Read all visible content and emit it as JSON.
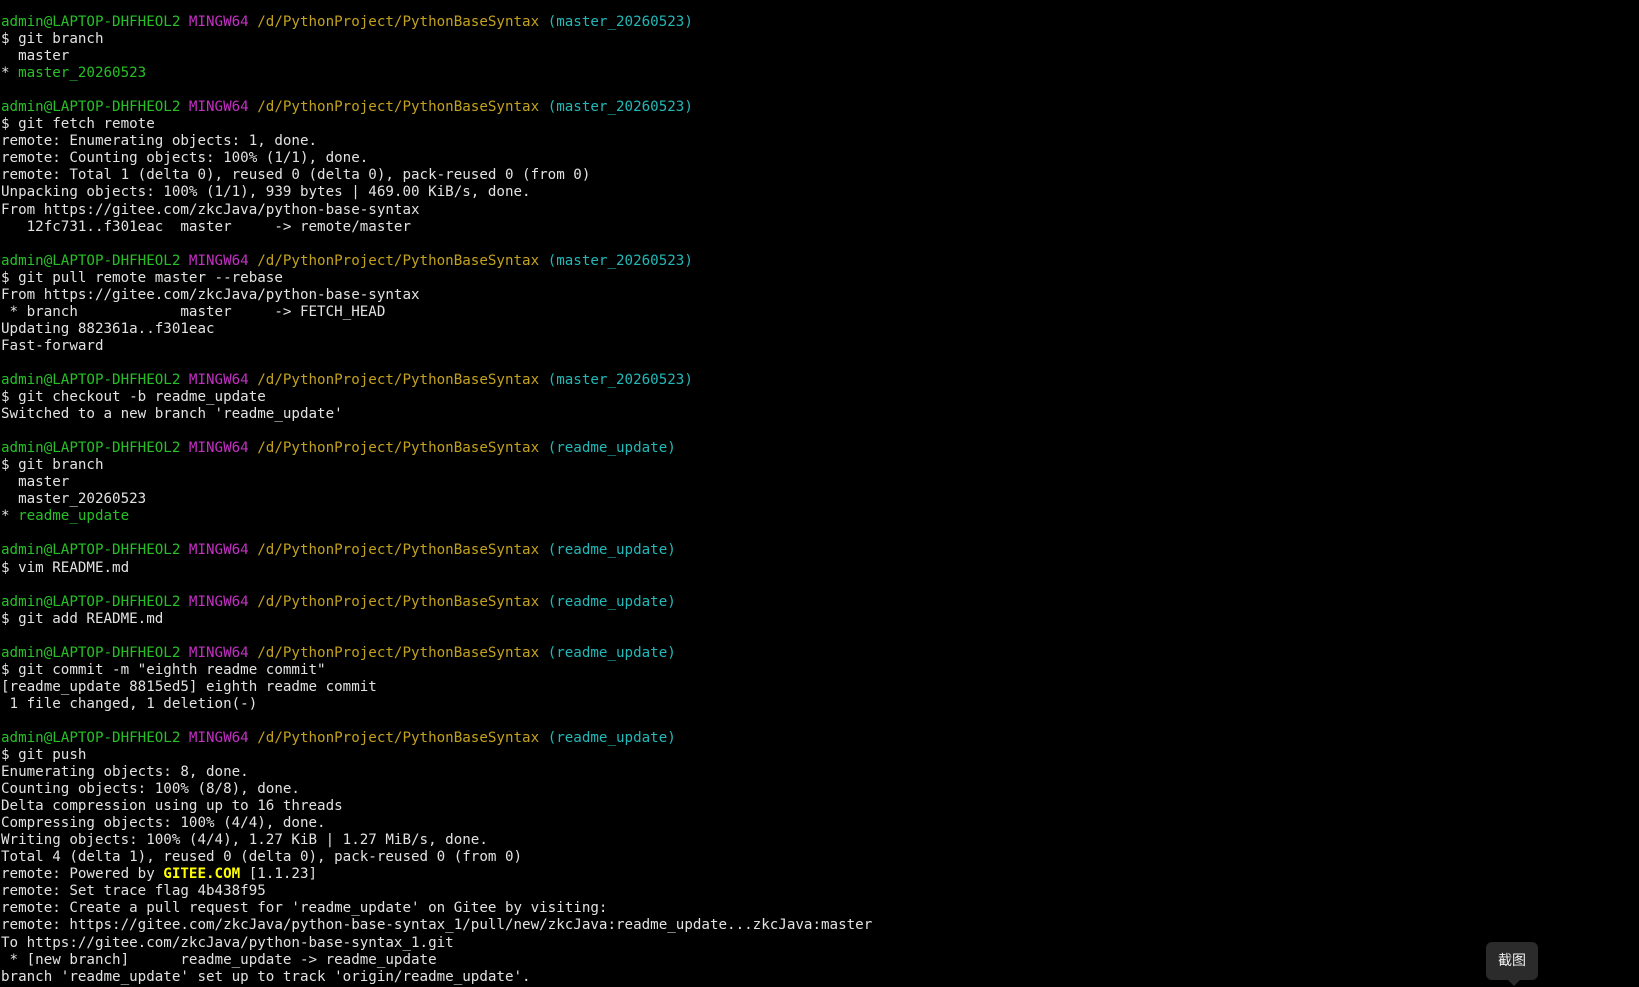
{
  "prompt": {
    "user_host": "admin@LAPTOP-DHFHEOL2",
    "env": "MINGW64",
    "path": "/d/PythonProject/PythonBaseSyntax"
  },
  "blocks": [
    {
      "branch": "(master_20260523)",
      "command": "$ git branch",
      "output": [
        {
          "text": "  master"
        },
        {
          "text": "* ",
          "current": "master_20260523"
        }
      ]
    },
    {
      "branch": "(master_20260523)",
      "command": "$ git fetch remote",
      "output": [
        {
          "text": "remote: Enumerating objects: 1, done."
        },
        {
          "text": "remote: Counting objects: 100% (1/1), done."
        },
        {
          "text": "remote: Total 1 (delta 0), reused 0 (delta 0), pack-reused 0 (from 0)"
        },
        {
          "text": "Unpacking objects: 100% (1/1), 939 bytes | 469.00 KiB/s, done."
        },
        {
          "text": "From https://gitee.com/zkcJava/python-base-syntax"
        },
        {
          "text": "   12fc731..f301eac  master     -> remote/master"
        }
      ]
    },
    {
      "branch": "(master_20260523)",
      "command": "$ git pull remote master --rebase",
      "output": [
        {
          "text": "From https://gitee.com/zkcJava/python-base-syntax"
        },
        {
          "text": " * branch            master     -> FETCH_HEAD"
        },
        {
          "text": "Updating 882361a..f301eac"
        },
        {
          "text": "Fast-forward"
        }
      ]
    },
    {
      "branch": "(master_20260523)",
      "command": "$ git checkout -b readme_update",
      "output": [
        {
          "text": "Switched to a new branch 'readme_update'"
        }
      ]
    },
    {
      "branch": "(readme_update)",
      "command": "$ git branch",
      "output": [
        {
          "text": "  master"
        },
        {
          "text": "  master_20260523"
        },
        {
          "text": "* ",
          "current": "readme_update"
        }
      ]
    },
    {
      "branch": "(readme_update)",
      "command": "$ vim README.md",
      "output": []
    },
    {
      "branch": "(readme_update)",
      "command": "$ git add README.md",
      "output": []
    },
    {
      "branch": "(readme_update)",
      "command": "$ git commit -m \"eighth readme commit\"",
      "output": [
        {
          "text": "[readme_update 8815ed5] eighth readme commit"
        },
        {
          "text": " 1 file changed, 1 deletion(-)"
        }
      ]
    },
    {
      "branch": "(readme_update)",
      "command": "$ git push",
      "output": [
        {
          "text": "Enumerating objects: 8, done."
        },
        {
          "text": "Counting objects: 100% (8/8), done."
        },
        {
          "text": "Delta compression using up to 16 threads"
        },
        {
          "text": "Compressing objects: 100% (4/4), done."
        },
        {
          "text": "Writing objects: 100% (4/4), 1.27 KiB | 1.27 MiB/s, done."
        },
        {
          "text": "Total 4 (delta 1), reused 0 (delta 0), pack-reused 0 (from 0)"
        },
        {
          "text": "remote: Powered by ",
          "highlight": "GITEE.COM",
          "after": " [1.1.23]"
        },
        {
          "text": "remote: Set trace flag 4b438f95"
        },
        {
          "text": "remote: Create a pull request for 'readme_update' on Gitee by visiting:"
        },
        {
          "text": "remote: https://gitee.com/zkcJava/python-base-syntax_1/pull/new/zkcJava:readme_update...zkcJava:master"
        },
        {
          "text": "To https://gitee.com/zkcJava/python-base-syntax_1.git"
        },
        {
          "text": " * [new branch]      readme_update -> readme_update"
        },
        {
          "text": "branch 'readme_update' set up to track 'origin/readme_update'."
        }
      ]
    }
  ],
  "screenshot_button": {
    "label": "截图"
  },
  "colors": {
    "background": "#000000",
    "text": "#e2e2e2",
    "user": "#26c026",
    "env": "#c52fc5",
    "path": "#c3a21d",
    "branch": "#23b8b8",
    "highlight": "#ffff00"
  }
}
